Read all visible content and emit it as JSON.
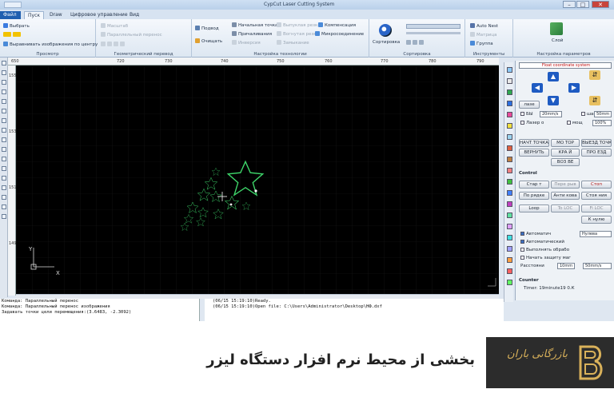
{
  "app": {
    "title": "CypCut Laser Cutting System"
  },
  "window_controls": {
    "minimize": "–",
    "maximize": "□",
    "close": "✕"
  },
  "tabs": [
    {
      "label": "Файл"
    },
    {
      "label": "Пуск"
    },
    {
      "label": "Draw"
    },
    {
      "label": "Цифровое управление"
    },
    {
      "label": "Вид"
    }
  ],
  "ribbon": {
    "view": {
      "select": "Выбрать",
      "align_center": "Выравнивать изображения по центру",
      "caption": "Просмотр"
    },
    "geometry": {
      "scale": "Масштаб",
      "parallel_move": "Параллельный перенос",
      "caption": "Геометрический перевод"
    },
    "tech": {
      "lead_in": "Подвод",
      "clean": "Очищать",
      "start_point": "Начальная точка",
      "cut_out": "Выпуклая резка",
      "compensation": "Компенсация",
      "seal": "Причаливания",
      "cut_in": "Вогнутая резка",
      "micro_joint": "Микросоединение",
      "invert": "Инверсия",
      "closing": "Замыкание",
      "caption": "Настройка технологии"
    },
    "sort": {
      "sort_button": "Сортировка",
      "caption": "Сортировка"
    },
    "tools": {
      "auto_nest": "Auto Nest",
      "matrix": "Матрица",
      "group": "Группа",
      "caption": "Инструменты"
    },
    "params": {
      "layer": "Слой",
      "caption": "Настройка параметров"
    }
  },
  "ruler_h": [
    "650",
    "720",
    "730",
    "740",
    "750",
    "760",
    "770",
    "780",
    "790",
    "800",
    "810"
  ],
  "ruler_v": [
    "1550",
    "1530",
    "1510",
    "1490"
  ],
  "canvas": {
    "axis_x": "X",
    "axis_y": "Y"
  },
  "colors": {
    "layer_colors": [
      "#8cc9f5",
      "#e8e8e8",
      "#2fa84f",
      "#2b6fe0",
      "#e94b9a",
      "#f0e040",
      "#9bd4ee",
      "#e06040",
      "#c08040",
      "#f08080",
      "#40c040",
      "#4080ff",
      "#c040c0",
      "#60e0a0",
      "#e0a0ff",
      "#40e0e0",
      "#a0a0ff",
      "#ffa040",
      "#ff6060",
      "#60ff60"
    ],
    "star_outline": "#3ed66a",
    "canvas_bg": "#000000",
    "accent": "#1e5bc2"
  },
  "panel": {
    "coord_system": "Float coordinate system",
    "laser_label": "лазе",
    "low": "БЫ",
    "speed1": "20mm/s",
    "step": "шаг",
    "step_val": "50mm",
    "laser_on": "Лазер о",
    "power": "мощ",
    "power_val": "100%",
    "origin": "НАЧТ ТОЧКА",
    "motor": "МО ТОР",
    "frame": "ВЫЕЗД ТОЧК",
    "back": "ВЕРНУТЬ",
    "edge": "КРА Й",
    "drive": "ПРО ЕЗД",
    "zoom": "ВОЗ ВЕ",
    "control_title": "Control",
    "start": "Стар т",
    "stop": "Стоп",
    "pause": "Пере рыв",
    "forward": "По рядке",
    "anti": "Анти кова",
    "back2": "Стоя ния",
    "loop": "Loop",
    "to_loc": "To LOC",
    "fi_loc": "Fi LOC",
    "zero": "К нулю",
    "auto_check": "Автоматич",
    "zero_btn": "Нулева",
    "auto2": "Автоматический",
    "done_check": "Выполнять обрабо",
    "protect": "Начать защиту маг",
    "distance": "Расстояни",
    "dist_val": "10mm",
    "speed2": "50mm/s",
    "counter_title": "Counter",
    "timer": "Timer: 19minute19 0.К"
  },
  "console": [
    "Команда: Параллельный перенос",
    "Команда: Параллельный перенос изображения",
    "Задавать точки цели перемещения:(3.6483, -2.3092)"
  ],
  "log": [
    "(06/15 15:19:10)Ready.",
    "(06/15 15:19:10)Open file: C:\\Users\\Administrator\\Desktop\\НФ.dxf"
  ],
  "caption": "بخشی از محیط نرم افزار دستگاه لیزر",
  "logo": {
    "script": "بازرگانی باران"
  }
}
